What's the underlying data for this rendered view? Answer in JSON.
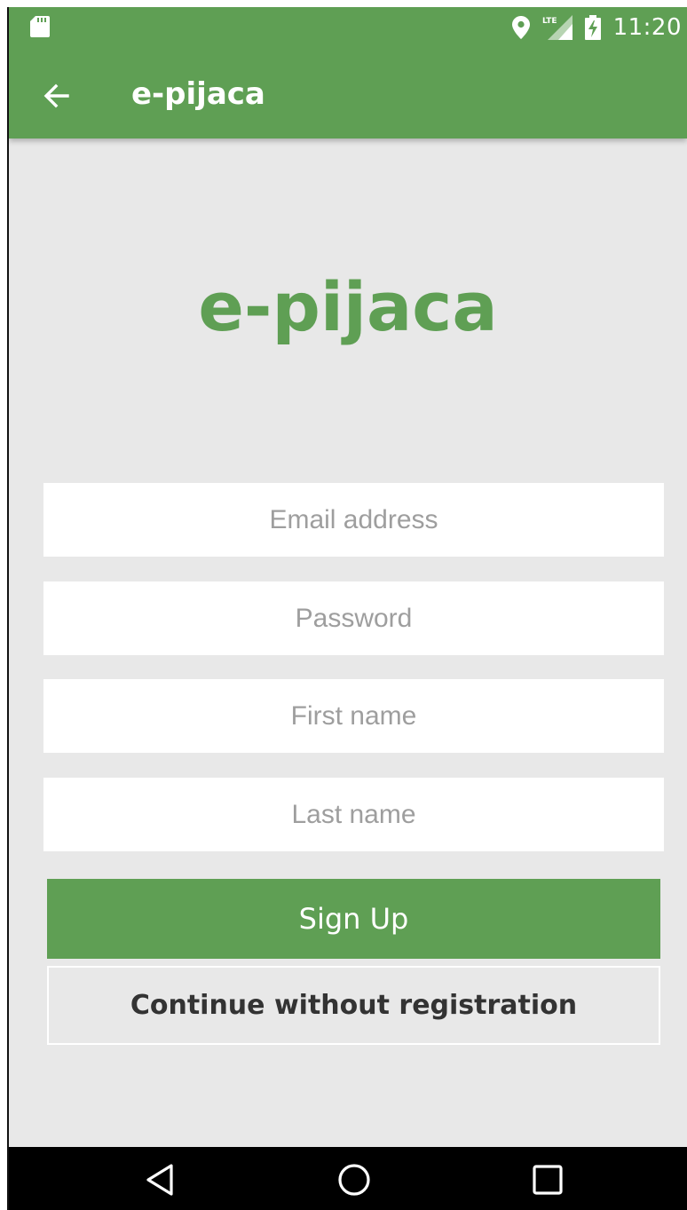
{
  "status_bar": {
    "time": "11:20",
    "icons": [
      "sd-card-icon",
      "location-icon",
      "lte-signal-icon",
      "battery-charging-icon"
    ]
  },
  "app_bar": {
    "title": "e-pijaca",
    "back_icon": "arrow-left-icon"
  },
  "logo": {
    "text": "e-pijaca"
  },
  "form": {
    "email_placeholder": "Email address",
    "password_placeholder": "Password",
    "first_name_placeholder": "First name",
    "last_name_placeholder": "Last name",
    "signup_label": "Sign Up",
    "guest_label": "Continue without registration"
  },
  "nav_bar": {
    "icons": [
      "back-triangle-icon",
      "home-circle-icon",
      "recents-square-icon"
    ]
  },
  "colors": {
    "primary": "#5f9f54",
    "background": "#e8e8e8",
    "field": "#ffffff",
    "nav": "#000000"
  }
}
